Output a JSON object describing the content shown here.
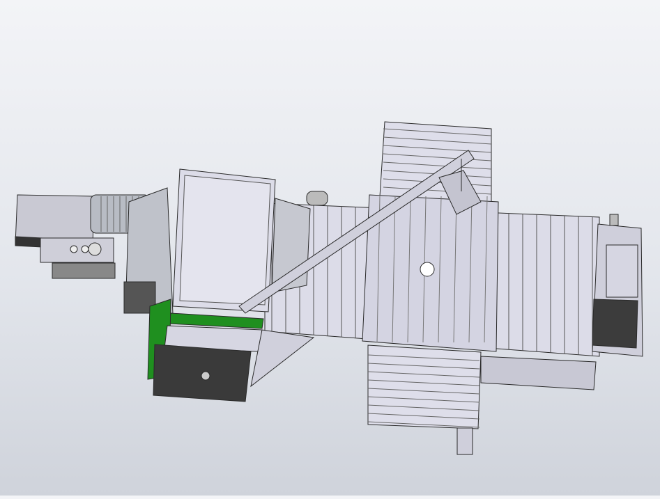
{
  "viewport": {
    "background_top": "#f3f4f7",
    "background_bottom": "#cfd3db"
  },
  "model": {
    "body_color": "#d9d9e6",
    "shadow_color": "#3c3c3c",
    "accent_color": "#1f8f1f",
    "edge_color": "#2a2a2a"
  }
}
